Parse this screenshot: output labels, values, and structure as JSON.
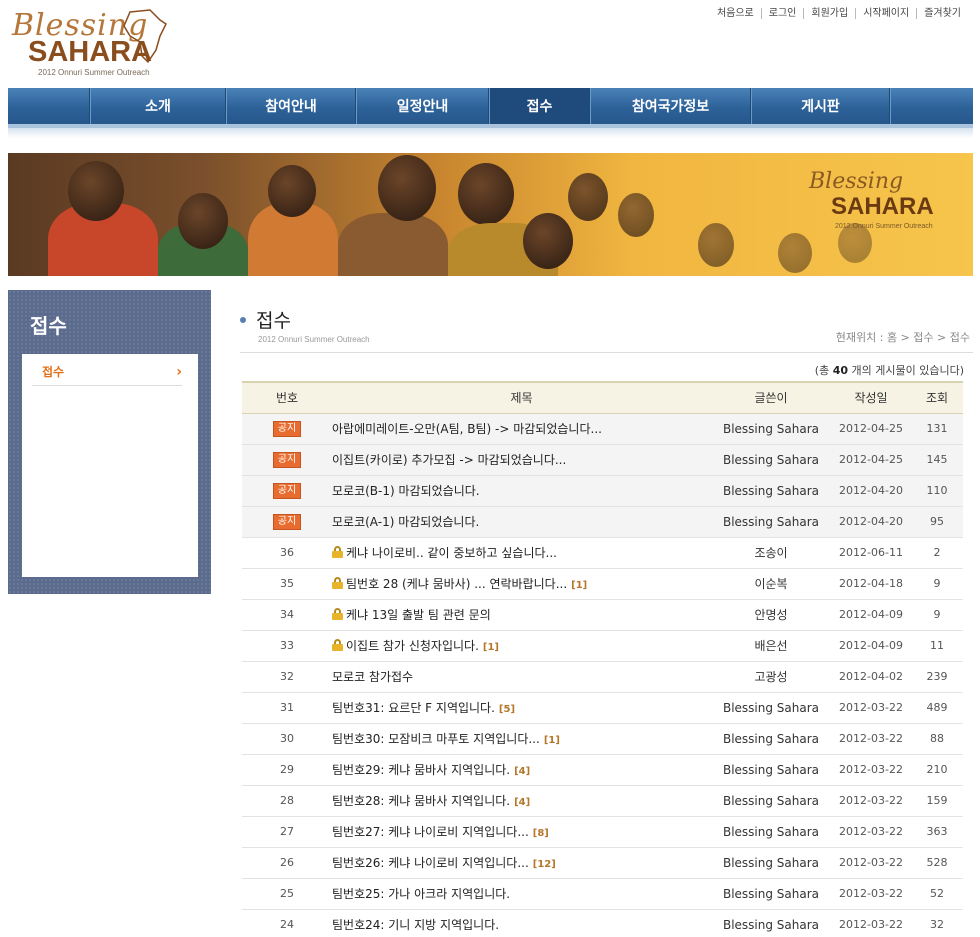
{
  "logo": {
    "script": "Blessing",
    "brand": "SAHARA",
    "sub": "2012 Onnuri Summer Outreach"
  },
  "topnav": [
    "처음으로",
    "로그인",
    "회원가입",
    "시작페이지",
    "즐겨찾기"
  ],
  "mainnav": [
    {
      "label": "소개",
      "active": false
    },
    {
      "label": "참여안내",
      "active": false
    },
    {
      "label": "일정안내",
      "active": false
    },
    {
      "label": "접수",
      "active": true
    },
    {
      "label": "참여국가정보",
      "active": false
    },
    {
      "label": "게시판",
      "active": false
    }
  ],
  "banner": {
    "script": "Blessing",
    "brand": "SAHARA",
    "sub": "2012 Onnuri Summer Outreach"
  },
  "sidebar": {
    "title": "접수",
    "items": [
      {
        "label": "접수"
      }
    ]
  },
  "content": {
    "title": "접수",
    "subtitle": "2012 Onnuri Summer Outreach",
    "breadcrumb": "현재위치 : 홈 >  접수 > 접수",
    "count_prefix": "(총 ",
    "count_value": "40",
    "count_suffix": " 개의 게시물이 있습니다)"
  },
  "table": {
    "headers": {
      "no": "번호",
      "title": "제목",
      "writer": "글쓴이",
      "date": "작성일",
      "hit": "조회"
    },
    "notice_label": "공지",
    "rows": [
      {
        "notice": true,
        "no": "",
        "title": "아랍에미레이트-오만(A팀, B팀) -> 마감되었습니다...",
        "locked": false,
        "comments": "",
        "writer": "Blessing Sahara",
        "date": "2012-04-25",
        "hit": "131"
      },
      {
        "notice": true,
        "no": "",
        "title": "이집트(카이로) 추가모집 -> 마감되었습니다...",
        "locked": false,
        "comments": "",
        "writer": "Blessing Sahara",
        "date": "2012-04-25",
        "hit": "145"
      },
      {
        "notice": true,
        "no": "",
        "title": "모로코(B-1) 마감되었습니다.",
        "locked": false,
        "comments": "",
        "writer": "Blessing Sahara",
        "date": "2012-04-20",
        "hit": "110"
      },
      {
        "notice": true,
        "no": "",
        "title": "모로코(A-1) 마감되었습니다.",
        "locked": false,
        "comments": "",
        "writer": "Blessing Sahara",
        "date": "2012-04-20",
        "hit": "95"
      },
      {
        "notice": false,
        "no": "36",
        "title": "케냐 나이로비.. 같이 중보하고 싶습니다...",
        "locked": true,
        "comments": "",
        "writer": "조송이",
        "date": "2012-06-11",
        "hit": "2"
      },
      {
        "notice": false,
        "no": "35",
        "title": "팀번호 28 (케냐 뭄바사) ... 연락바랍니다...",
        "locked": true,
        "comments": "[1]",
        "writer": "이순복",
        "date": "2012-04-18",
        "hit": "9"
      },
      {
        "notice": false,
        "no": "34",
        "title": "케냐 13일 출발 팀 관련 문의",
        "locked": true,
        "comments": "",
        "writer": "안명성",
        "date": "2012-04-09",
        "hit": "9"
      },
      {
        "notice": false,
        "no": "33",
        "title": "이집트 참가 신청자입니다.",
        "locked": true,
        "comments": "[1]",
        "writer": "배은선",
        "date": "2012-04-09",
        "hit": "11"
      },
      {
        "notice": false,
        "no": "32",
        "title": "모로코 참가접수",
        "locked": false,
        "comments": "",
        "writer": "고광성",
        "date": "2012-04-02",
        "hit": "239"
      },
      {
        "notice": false,
        "no": "31",
        "title": "팀번호31: 요르단 F 지역입니다.",
        "locked": false,
        "comments": "[5]",
        "writer": "Blessing Sahara",
        "date": "2012-03-22",
        "hit": "489"
      },
      {
        "notice": false,
        "no": "30",
        "title": "팀번호30: 모잠비크 마푸토 지역입니다...",
        "locked": false,
        "comments": "[1]",
        "writer": "Blessing Sahara",
        "date": "2012-03-22",
        "hit": "88"
      },
      {
        "notice": false,
        "no": "29",
        "title": "팀번호29: 케냐 뭄바사 지역입니다.",
        "locked": false,
        "comments": "[4]",
        "writer": "Blessing Sahara",
        "date": "2012-03-22",
        "hit": "210"
      },
      {
        "notice": false,
        "no": "28",
        "title": "팀번호28: 케냐 뭄바사 지역입니다.",
        "locked": false,
        "comments": "[4]",
        "writer": "Blessing Sahara",
        "date": "2012-03-22",
        "hit": "159"
      },
      {
        "notice": false,
        "no": "27",
        "title": "팀번호27: 케냐 나이로비 지역입니다...",
        "locked": false,
        "comments": "[8]",
        "writer": "Blessing Sahara",
        "date": "2012-03-22",
        "hit": "363"
      },
      {
        "notice": false,
        "no": "26",
        "title": "팀번호26: 케냐 나이로비 지역입니다...",
        "locked": false,
        "comments": "[12]",
        "writer": "Blessing Sahara",
        "date": "2012-03-22",
        "hit": "528"
      },
      {
        "notice": false,
        "no": "25",
        "title": "팀번호25: 가나 아크라 지역입니다.",
        "locked": false,
        "comments": "",
        "writer": "Blessing Sahara",
        "date": "2012-03-22",
        "hit": "52"
      },
      {
        "notice": false,
        "no": "24",
        "title": "팀번호24: 기니 지방 지역입니다.",
        "locked": false,
        "comments": "",
        "writer": "Blessing Sahara",
        "date": "2012-03-22",
        "hit": "32"
      }
    ]
  },
  "colors": {
    "nav": "#2d6299",
    "accent": "#e2701a",
    "sidebar": "#5b6b8e",
    "notice_badge": "#e86c2f"
  }
}
